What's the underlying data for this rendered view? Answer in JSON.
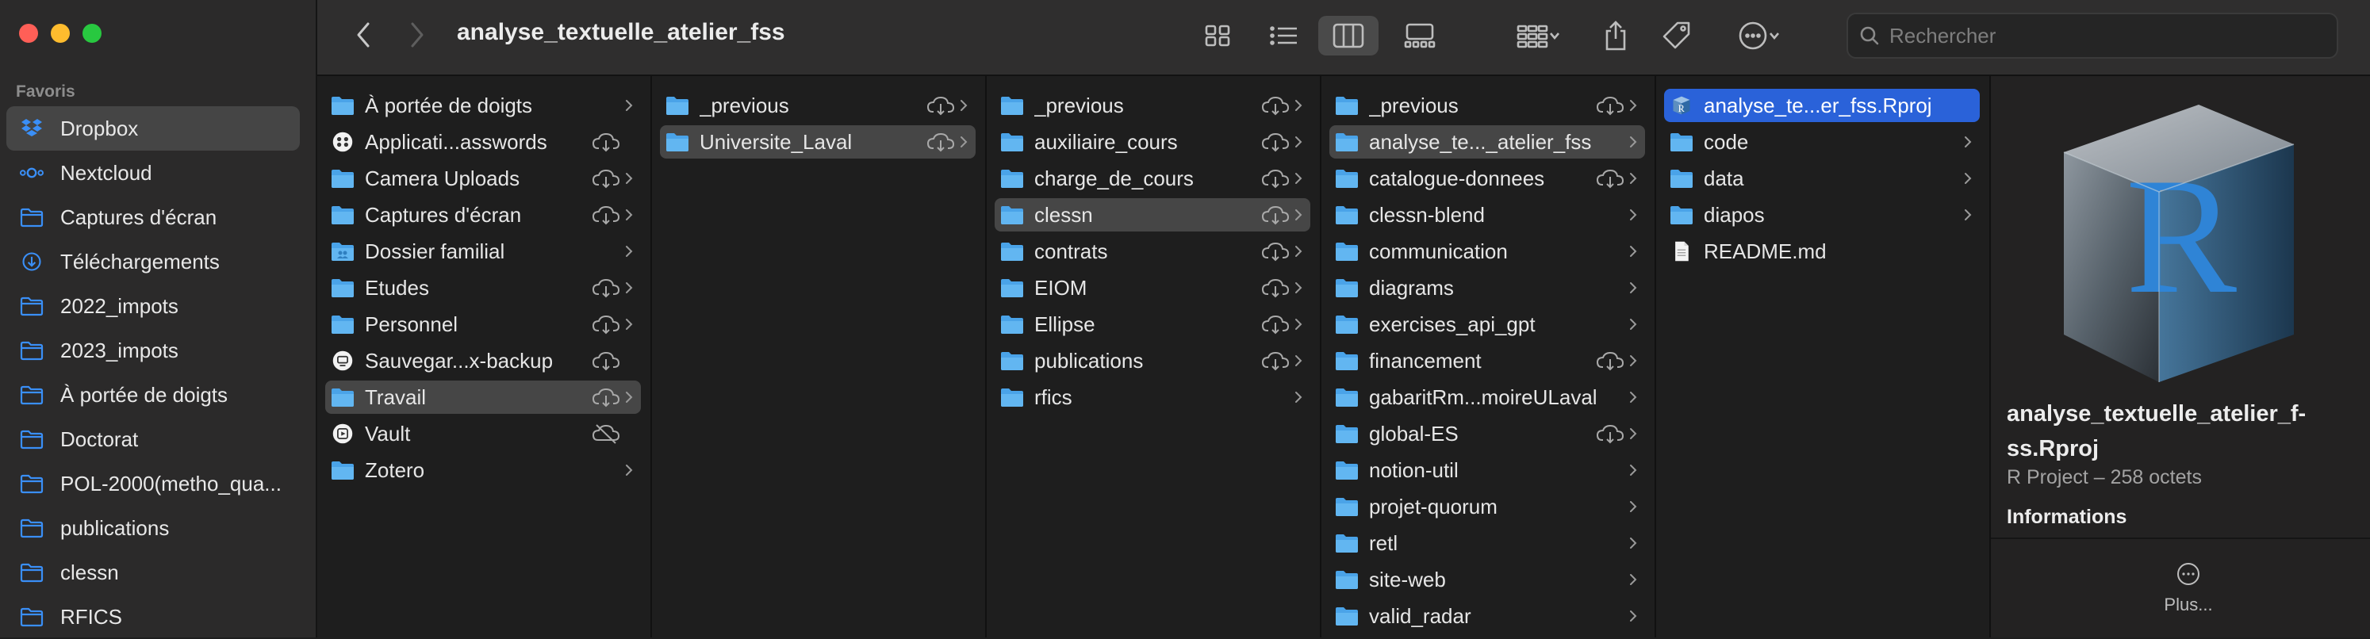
{
  "window": {
    "title": "analyse_textuelle_atelier_fss",
    "search_placeholder": "Rechercher"
  },
  "sidebar": {
    "section_title": "Favoris",
    "items": [
      {
        "label": "Dropbox",
        "icon": "dropbox-icon",
        "selected": true
      },
      {
        "label": "Nextcloud",
        "icon": "nextcloud-icon"
      },
      {
        "label": "Captures d'écran",
        "icon": "folder-icon"
      },
      {
        "label": "Téléchargements",
        "icon": "download-icon"
      },
      {
        "label": "2022_impots",
        "icon": "folder-icon"
      },
      {
        "label": "2023_impots",
        "icon": "folder-icon"
      },
      {
        "label": "À portée de doigts",
        "icon": "folder-icon"
      },
      {
        "label": "Doctorat",
        "icon": "folder-icon"
      },
      {
        "label": "POL-2000(metho_qua...",
        "icon": "folder-icon"
      },
      {
        "label": "publications",
        "icon": "folder-icon"
      },
      {
        "label": "clessn",
        "icon": "folder-icon"
      },
      {
        "label": "RFICS",
        "icon": "folder-icon"
      }
    ]
  },
  "columns": [
    {
      "items": [
        {
          "label": "À portée de doigts",
          "icon": "folder-icon",
          "cloud": "none",
          "chevron": true
        },
        {
          "label": "Applicati...asswords",
          "icon": "app-icon",
          "cloud": "download",
          "chevron": false
        },
        {
          "label": "Camera Uploads",
          "icon": "folder-icon",
          "cloud": "download",
          "chevron": true
        },
        {
          "label": "Captures d'écran",
          "icon": "folder-icon",
          "cloud": "download",
          "chevron": true
        },
        {
          "label": "Dossier familial",
          "icon": "shared-folder-icon",
          "cloud": "none",
          "chevron": true
        },
        {
          "label": "Etudes",
          "icon": "folder-icon",
          "cloud": "download",
          "chevron": true
        },
        {
          "label": "Personnel",
          "icon": "folder-icon",
          "cloud": "download",
          "chevron": true
        },
        {
          "label": "Sauvegar...x-backup",
          "icon": "backup-icon",
          "cloud": "download",
          "chevron": false
        },
        {
          "label": "Travail",
          "icon": "folder-icon",
          "cloud": "download",
          "chevron": true,
          "state": "selected"
        },
        {
          "label": "Vault",
          "icon": "vault-icon",
          "cloud": "offline",
          "chevron": false
        },
        {
          "label": "Zotero",
          "icon": "folder-icon",
          "cloud": "none",
          "chevron": true
        }
      ]
    },
    {
      "items": [
        {
          "label": "_previous",
          "icon": "folder-icon",
          "cloud": "download",
          "chevron": true
        },
        {
          "label": "Universite_Laval",
          "icon": "folder-icon",
          "cloud": "download",
          "chevron": true,
          "state": "selected"
        }
      ]
    },
    {
      "items": [
        {
          "label": "_previous",
          "icon": "folder-icon",
          "cloud": "download",
          "chevron": true
        },
        {
          "label": "auxiliaire_cours",
          "icon": "folder-icon",
          "cloud": "download",
          "chevron": true
        },
        {
          "label": "charge_de_cours",
          "icon": "folder-icon",
          "cloud": "download",
          "chevron": true
        },
        {
          "label": "clessn",
          "icon": "folder-icon",
          "cloud": "download",
          "chevron": true,
          "state": "selected"
        },
        {
          "label": "contrats",
          "icon": "folder-icon",
          "cloud": "download",
          "chevron": true
        },
        {
          "label": "EIOM",
          "icon": "folder-icon",
          "cloud": "download",
          "chevron": true
        },
        {
          "label": "Ellipse",
          "icon": "folder-icon",
          "cloud": "download",
          "chevron": true
        },
        {
          "label": "publications",
          "icon": "folder-icon",
          "cloud": "download",
          "chevron": true
        },
        {
          "label": "rfics",
          "icon": "folder-icon",
          "cloud": "none",
          "chevron": true
        }
      ]
    },
    {
      "items": [
        {
          "label": "_previous",
          "icon": "folder-icon",
          "cloud": "download",
          "chevron": true
        },
        {
          "label": "analyse_te..._atelier_fss",
          "icon": "folder-icon",
          "cloud": "none",
          "chevron": true,
          "state": "selected"
        },
        {
          "label": "catalogue-donnees",
          "icon": "folder-icon",
          "cloud": "download",
          "chevron": true
        },
        {
          "label": "clessn-blend",
          "icon": "folder-icon",
          "cloud": "none",
          "chevron": true
        },
        {
          "label": "communication",
          "icon": "folder-icon",
          "cloud": "none",
          "chevron": true
        },
        {
          "label": "diagrams",
          "icon": "folder-icon",
          "cloud": "none",
          "chevron": true
        },
        {
          "label": "exercises_api_gpt",
          "icon": "folder-icon",
          "cloud": "none",
          "chevron": true
        },
        {
          "label": "financement",
          "icon": "folder-icon",
          "cloud": "download",
          "chevron": true
        },
        {
          "label": "gabaritRm...moireULaval",
          "icon": "folder-icon",
          "cloud": "none",
          "chevron": true
        },
        {
          "label": "global-ES",
          "icon": "folder-icon",
          "cloud": "download",
          "chevron": true
        },
        {
          "label": "notion-util",
          "icon": "folder-icon",
          "cloud": "none",
          "chevron": true
        },
        {
          "label": "projet-quorum",
          "icon": "folder-icon",
          "cloud": "none",
          "chevron": true
        },
        {
          "label": "retl",
          "icon": "folder-icon",
          "cloud": "none",
          "chevron": true
        },
        {
          "label": "site-web",
          "icon": "folder-icon",
          "cloud": "none",
          "chevron": true
        },
        {
          "label": "valid_radar",
          "icon": "folder-icon",
          "cloud": "none",
          "chevron": true
        }
      ]
    },
    {
      "items": [
        {
          "label": "analyse_te...er_fss.Rproj",
          "icon": "rproj-icon",
          "cloud": "none",
          "chevron": false,
          "state": "active"
        },
        {
          "label": "code",
          "icon": "folder-icon",
          "cloud": "none",
          "chevron": true
        },
        {
          "label": "data",
          "icon": "folder-icon",
          "cloud": "none",
          "chevron": true
        },
        {
          "label": "diapos",
          "icon": "folder-icon",
          "cloud": "none",
          "chevron": true
        },
        {
          "label": "README.md",
          "icon": "document-icon",
          "cloud": "none",
          "chevron": false
        }
      ]
    }
  ],
  "preview": {
    "file_name": "analyse_textuelle_atelier_f-ss.Rproj",
    "kind": "R Project – 258 octets",
    "info_heading": "Informations",
    "more_label": "Plus..."
  },
  "colors": {
    "accent": "#2a62d9",
    "folder": "#4aa3e8",
    "selected_row": "#464646"
  }
}
